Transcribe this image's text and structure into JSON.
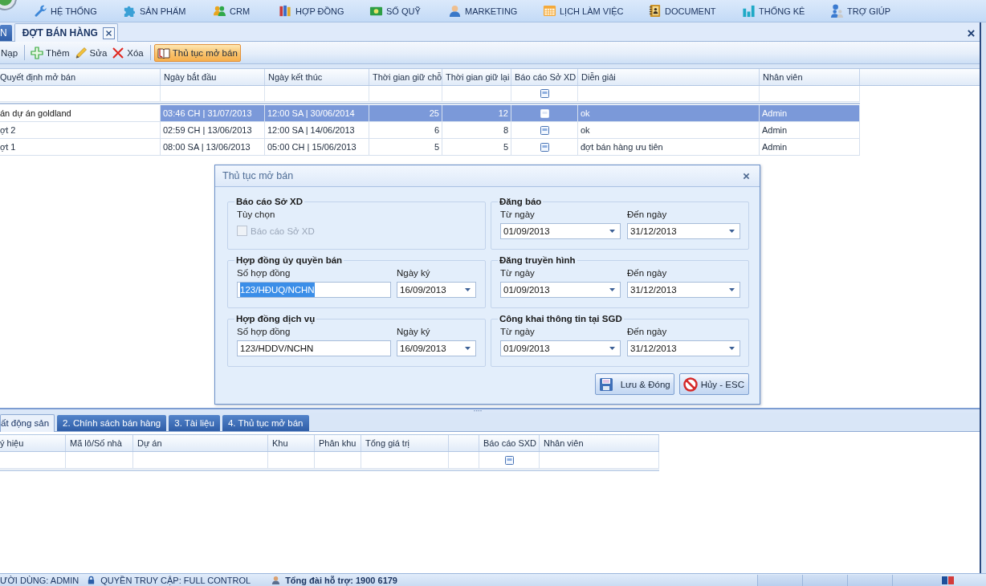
{
  "menu_bar": {
    "items": [
      "HỆ THỐNG",
      "SẢN PHẨM",
      "CRM",
      "HỢP ĐỒNG",
      "SỐ QUỸ",
      "MARKETING",
      "LỊCH LÀM VIỆC",
      "DOCUMENT",
      "THỐNG KÊ",
      "TRỢ GIÚP"
    ]
  },
  "document_tabs": [
    {
      "label": "N",
      "selected": false,
      "closable": false
    },
    {
      "label": "ĐỢT BÁN HÀNG",
      "selected": true,
      "closable": true
    }
  ],
  "toolbar": [
    {
      "kind": "reload",
      "label": "Nạp",
      "active": false
    },
    {
      "kind": "separator"
    },
    {
      "kind": "add",
      "label": "Thêm",
      "active": false
    },
    {
      "kind": "edit",
      "label": "Sửa",
      "active": false
    },
    {
      "kind": "delete",
      "label": "Xóa",
      "active": false
    },
    {
      "kind": "separator"
    },
    {
      "kind": "procedure",
      "label": "Thủ tục mở bán",
      "active": true
    }
  ],
  "main_grid": {
    "columns": [
      "Quyết định mở bán",
      "Ngày bắt đầu",
      "Ngày kết thúc",
      "Thời gian giữ chỗ",
      "Thời gian giữ lại",
      "Báo cáo Sở XD",
      "Diễn giải",
      "Nhân viên"
    ],
    "filter_row": {
      "report_checked": false
    },
    "rows": [
      {
        "selected": true,
        "decision": "án dự án goldland",
        "start": "03:46 CH | 31/07/2013",
        "end": "12:00 SA | 30/06/2014",
        "hold_days": "25",
        "keep_days": "12",
        "report_checked": false,
        "note": "ok",
        "staff": "Admin"
      },
      {
        "selected": false,
        "decision": "ợt 2",
        "start": "02:59 CH | 13/06/2013",
        "end": "12:00 SA | 14/06/2013",
        "hold_days": "6",
        "keep_days": "8",
        "report_checked": false,
        "note": "ok",
        "staff": "Admin"
      },
      {
        "selected": false,
        "decision": "ợt 1",
        "start": "08:00 SA | 13/06/2013",
        "end": "05:00 CH | 15/06/2013",
        "hold_days": "5",
        "keep_days": "5",
        "report_checked": false,
        "note": "đợt bán hàng ưu tiên",
        "staff": "Admin"
      }
    ]
  },
  "dialog": {
    "title": "Thủ tục mở bán",
    "groups": [
      {
        "kind": "checkbox",
        "title": "Báo cáo Sở XD",
        "option_label": "Tùy chọn",
        "checkbox": {
          "label": "Báo cáo Sở XD",
          "checked": false,
          "disabled": true
        }
      },
      {
        "kind": "date_range",
        "title": "Đăng báo",
        "from_label": "Từ ngày",
        "from": "01/09/2013",
        "to_label": "Đến ngày",
        "to": "31/12/2013"
      },
      {
        "kind": "contract",
        "title": "Hợp đồng ủy quyền bán",
        "number_label": "Số hợp đồng",
        "number": "123/HĐUQ/NCHN",
        "number_selected": true,
        "date_label": "Ngày ký",
        "date": "16/09/2013"
      },
      {
        "kind": "date_range",
        "title": "Đăng truyền hình",
        "from_label": "Từ ngày",
        "from": "01/09/2013",
        "to_label": "Đến ngày",
        "to": "31/12/2013"
      },
      {
        "kind": "contract",
        "title": "Hợp đồng dịch vụ",
        "number_label": "Số hợp đồng",
        "number": "123/HDDV/NCHN",
        "number_selected": false,
        "date_label": "Ngày ký",
        "date": "16/09/2013"
      },
      {
        "kind": "date_range",
        "title": "Công khai thông tin tại SGD",
        "from_label": "Từ ngày",
        "from": "01/09/2013",
        "to_label": "Đến ngày",
        "to": "31/12/2013"
      }
    ],
    "buttons": [
      {
        "kind": "save",
        "label": "Lưu & Đóng"
      },
      {
        "kind": "cancel",
        "label": "Hủy - ESC"
      }
    ]
  },
  "bottom_tabs": [
    {
      "label": "ất động sản",
      "selected": true
    },
    {
      "label": "2. Chính sách bán hàng",
      "selected": false
    },
    {
      "label": "3. Tài liệu",
      "selected": false
    },
    {
      "label": "4. Thủ tục mở bán",
      "selected": false
    }
  ],
  "detail_grid": {
    "columns": [
      "ý hiệu",
      "Mã lô/Số nhà",
      "Dự án",
      "Khu",
      "Phân khu",
      "Tổng giá trị",
      "Báo cáo SXD",
      "Nhân viên"
    ],
    "rows": [
      {
        "report_checked": false
      }
    ]
  },
  "status_bar": {
    "user": "ƯỜI DÙNG: ADMIN",
    "access": "QUYỀN TRUY CẬP: FULL CONTROL",
    "hotline": "Tổng đài hỗ trợ: 1900 6179"
  }
}
